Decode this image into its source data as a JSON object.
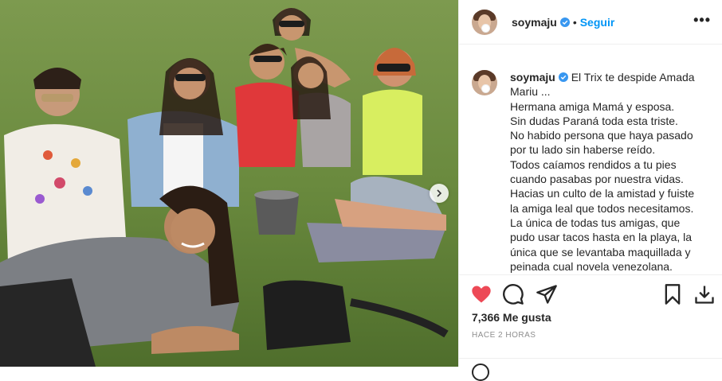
{
  "post": {
    "username": "soymaju",
    "separator": "•",
    "follow_label": "Seguir",
    "more_label": "•••",
    "caption_lines": [
      "El Trix te despide Amada",
      "Mariu ...",
      "Hermana amiga Mamá y esposa.",
      "Sin dudas Paraná toda esta triste.",
      "No habido persona que haya pasado",
      "por tu lado sin haberse reído.",
      "Todos caíamos rendidos a tu pies",
      "cuando pasabas por nuestra vidas.",
      "Hacias un culto de la amistad y fuiste",
      "la amiga leal que todos necesitamos.",
      "La única de todas tus amigas, que",
      "pudo usar tacos hasta en la playa, la",
      "única que se levantaba maquillada y",
      "peinada cual novela venezolana."
    ],
    "likes": "7,366 Me gusta",
    "timestamp": "HACE 2 HORAS"
  },
  "colors": {
    "accent": "#0095f6",
    "like": "#ed4956",
    "text": "#262626",
    "muted": "#8e8e8e"
  },
  "icons": [
    "verified-badge-icon",
    "heart-icon",
    "comment-icon",
    "share-icon",
    "bookmark-icon",
    "download-icon",
    "more-options-icon",
    "chevron-right-icon"
  ]
}
